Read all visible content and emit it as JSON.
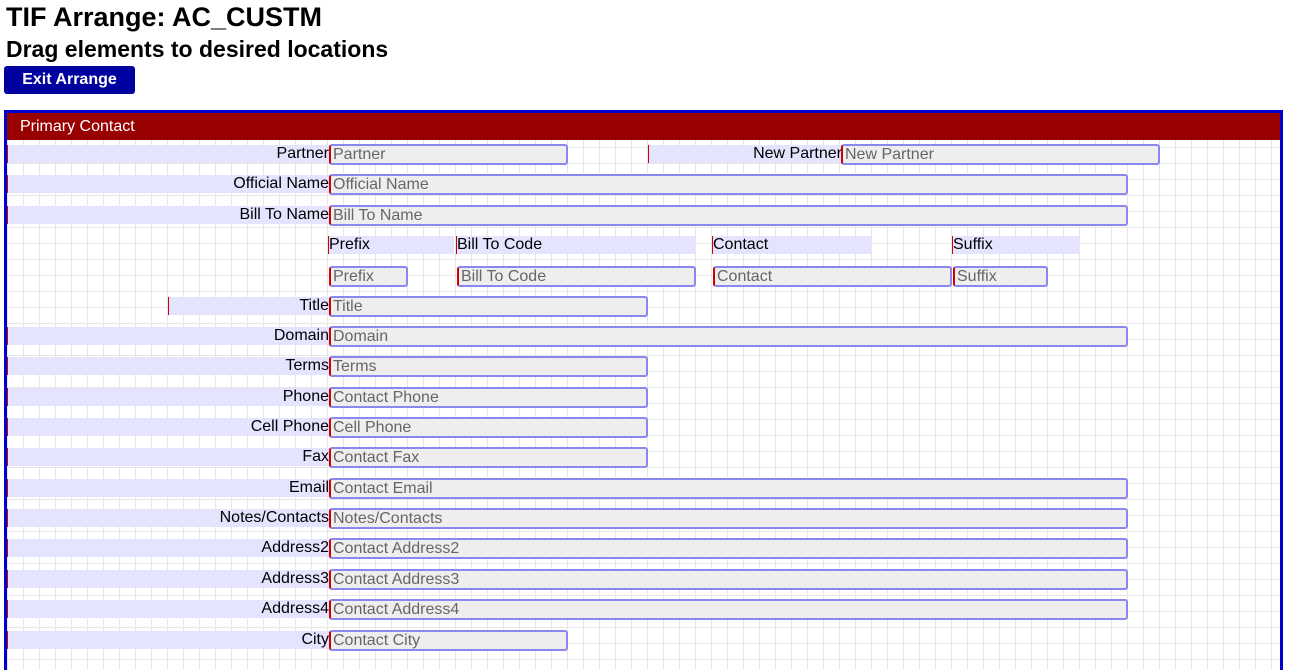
{
  "title": "TIF Arrange: AC_CUSTM",
  "subtitle": "Drag elements to desired locations",
  "exit_label": "Exit Arrange",
  "section": {
    "title": "Primary Contact"
  },
  "fields": {
    "partner": {
      "label": "Partner",
      "placeholder": "Partner"
    },
    "new_partner": {
      "label": "New Partner",
      "placeholder": "New Partner"
    },
    "official_name": {
      "label": "Official Name",
      "placeholder": "Official Name"
    },
    "bill_to_name": {
      "label": "Bill To Name",
      "placeholder": "Bill To Name"
    },
    "prefix": {
      "label": "Prefix",
      "placeholder": "Prefix"
    },
    "bill_to_code": {
      "label": "Bill To Code",
      "placeholder": "Bill To Code"
    },
    "contact": {
      "label": "Contact",
      "placeholder": "Contact"
    },
    "suffix": {
      "label": "Suffix",
      "placeholder": "Suffix"
    },
    "title": {
      "label": "Title",
      "placeholder": "Title"
    },
    "domain": {
      "label": "Domain",
      "placeholder": "Domain"
    },
    "terms": {
      "label": "Terms",
      "placeholder": "Terms"
    },
    "phone": {
      "label": "Phone",
      "placeholder": "Contact Phone"
    },
    "cell_phone": {
      "label": "Cell Phone",
      "placeholder": "Cell Phone"
    },
    "fax": {
      "label": "Fax",
      "placeholder": "Contact Fax"
    },
    "email": {
      "label": "Email",
      "placeholder": "Contact Email"
    },
    "notes": {
      "label": "Notes/Contacts",
      "placeholder": "Notes/Contacts"
    },
    "address2": {
      "label": "Address2",
      "placeholder": "Contact Address2"
    },
    "address3": {
      "label": "Address3",
      "placeholder": "Contact Address3"
    },
    "address4": {
      "label": "Address4",
      "placeholder": "Contact Address4"
    },
    "city": {
      "label": "City",
      "placeholder": "Contact City"
    }
  }
}
